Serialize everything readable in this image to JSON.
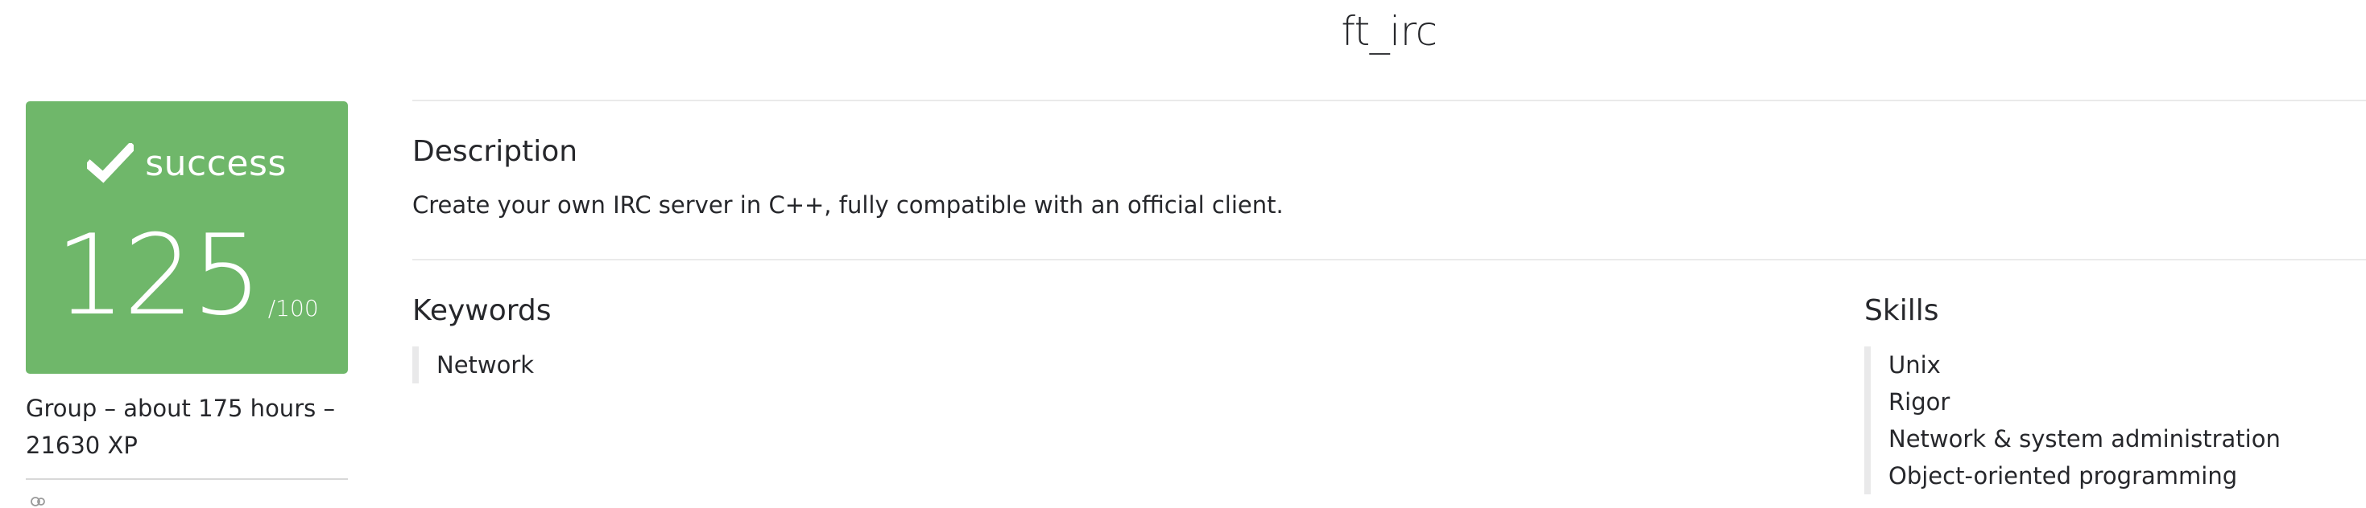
{
  "project": {
    "title": "ft_irc"
  },
  "result": {
    "status": "success",
    "score": "125",
    "max": "/100",
    "status_color": "#6fb76a",
    "status_icon": "checkmark-icon"
  },
  "meta": {
    "line1": "Group – about 175 hours –",
    "line2": "21630 XP",
    "members_icon": "users-icon"
  },
  "description": {
    "heading": "Description",
    "text": "Create your own IRC server in C++, fully compatible with an official client."
  },
  "keywords": {
    "heading": "Keywords",
    "items": [
      "Network"
    ]
  },
  "skills": {
    "heading": "Skills",
    "items": [
      "Unix",
      "Rigor",
      "Network & system administration",
      "Object-oriented programming"
    ]
  }
}
